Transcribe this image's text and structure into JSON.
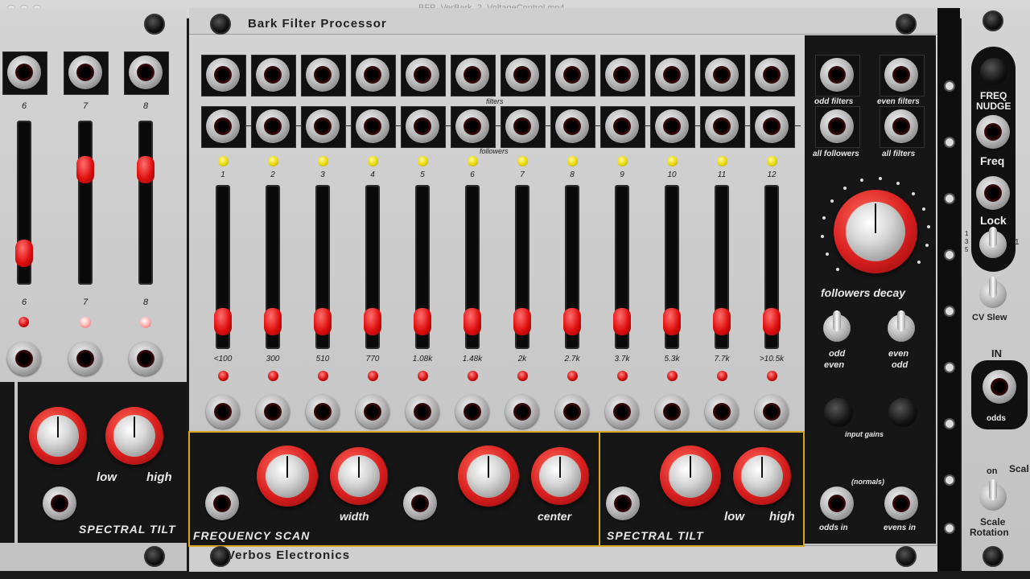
{
  "window": {
    "title": "BFP_VerBark_2_VoltageControl.mp4"
  },
  "module": {
    "name": "Bark Filter Processor",
    "brand": "Verbos Electronics"
  },
  "jack_rows": {
    "filters_label": "filters",
    "followers_label": "followers"
  },
  "channels": [
    "1",
    "2",
    "3",
    "4",
    "5",
    "6",
    "7",
    "8",
    "9",
    "10",
    "11",
    "12"
  ],
  "frequencies": [
    "<100",
    "300",
    "510",
    "770",
    "1.08k",
    "1.48k",
    "2k",
    "2.7k",
    "3.7k",
    "5.3k",
    "7.7k",
    ">10.5k"
  ],
  "fader_levels": [
    0.1,
    0.1,
    0.1,
    0.1,
    0.1,
    0.1,
    0.1,
    0.1,
    0.1,
    0.1,
    0.1,
    0.1
  ],
  "left_module": {
    "top_numbers": [
      "6",
      "7",
      "8"
    ],
    "mid_numbers": [
      "6",
      "7",
      "8"
    ],
    "fader_levels": [
      0.12,
      0.7,
      0.7
    ],
    "knob_labels": {
      "low": "low",
      "high": "high"
    },
    "section": "SPECTRAL TILT"
  },
  "bottom_sections": {
    "frequency_scan": "FREQUENCY SCAN",
    "width": "width",
    "center": "center",
    "spectral_tilt": "SPECTRAL TILT",
    "low": "low",
    "high": "high"
  },
  "right_section": {
    "odd_filters": "odd filters",
    "even_filters": "even filters",
    "all_followers": "all followers",
    "all_filters": "all filters",
    "followers_decay": "followers decay",
    "odd_even_1": "odd",
    "odd_even_2": "even",
    "even_odd_1": "even",
    "even_odd_2": "odd",
    "input_gains": "input gains",
    "normals": "(normals)",
    "odds_in": "odds in",
    "evens_in": "evens in"
  },
  "far_right": {
    "freq_nudge_1": "FREQ",
    "freq_nudge_2": "NUDGE",
    "freq": "Freq",
    "lock": "Lock",
    "lock_scale_1": "1",
    "lock_scale_2": "3",
    "lock_scale_3": "5",
    "lock_scale_4": "1",
    "cv_slew": "CV Slew",
    "in": "IN",
    "odds": "odds",
    "on": "on",
    "scale_rotation_1": "Scale",
    "scale_rotation_2": "Rotation",
    "scale_cut": "Scal"
  },
  "colors": {
    "accent_red": "#d81e1e",
    "led_yellow": "#e8d800",
    "frame_yellow": "#d9a81e",
    "panel_silver": "#c9c9c9"
  }
}
